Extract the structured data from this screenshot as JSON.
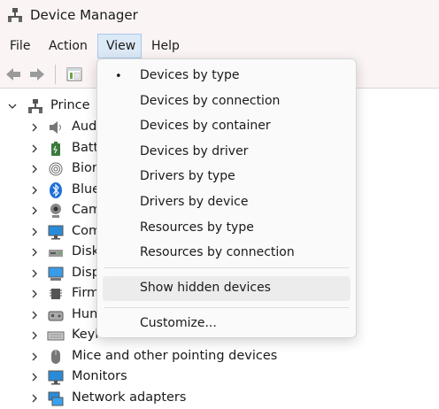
{
  "window": {
    "title": "Device Manager"
  },
  "menubar": {
    "file": "File",
    "action": "Action",
    "view": "View",
    "help": "Help"
  },
  "tree": {
    "root": "Prince",
    "items": [
      {
        "label": "Aud",
        "icon": "speaker-icon"
      },
      {
        "label": "Batt",
        "icon": "battery-icon"
      },
      {
        "label": "Bior",
        "icon": "fingerprint-icon"
      },
      {
        "label": "Blue",
        "icon": "bluetooth-icon"
      },
      {
        "label": "Cam",
        "icon": "webcam-icon"
      },
      {
        "label": "Com",
        "icon": "monitor-icon"
      },
      {
        "label": "Disk",
        "icon": "disk-drive-icon"
      },
      {
        "label": "Disp",
        "icon": "display-adapter-icon"
      },
      {
        "label": "Firm",
        "icon": "chip-icon"
      },
      {
        "label": "Hun",
        "icon": "hid-icon"
      },
      {
        "label": "Keyl",
        "icon": "keyboard-icon"
      },
      {
        "label": "Mice and other pointing devices",
        "icon": "mouse-icon"
      },
      {
        "label": "Monitors",
        "icon": "monitor-icon"
      },
      {
        "label": "Network adapters",
        "icon": "network-icon"
      }
    ]
  },
  "view_menu": {
    "items": [
      {
        "label": "Devices by type",
        "selected": true
      },
      {
        "label": "Devices by connection"
      },
      {
        "label": "Devices by container"
      },
      {
        "label": "Devices by driver"
      },
      {
        "label": "Drivers by type"
      },
      {
        "label": "Drivers by device"
      },
      {
        "label": "Resources by type"
      },
      {
        "label": "Resources by connection"
      }
    ],
    "show_hidden": "Show hidden devices",
    "customize": "Customize...",
    "bullet": "•"
  }
}
